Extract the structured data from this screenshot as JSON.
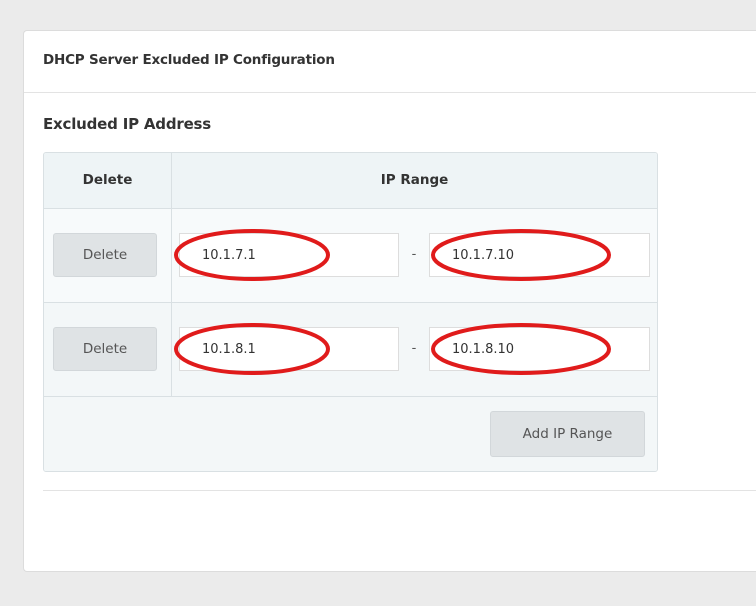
{
  "panel": {
    "title": "DHCP Server Excluded IP Configuration"
  },
  "section": {
    "title": "Excluded IP Address"
  },
  "table": {
    "headers": {
      "delete": "Delete",
      "ip_range": "IP Range"
    },
    "rows": [
      {
        "delete_label": "Delete",
        "start_ip": "10.1.7.1",
        "separator": "-",
        "end_ip": "10.1.7.10"
      },
      {
        "delete_label": "Delete",
        "start_ip": "10.1.8.1",
        "separator": "-",
        "end_ip": "10.1.8.10"
      }
    ],
    "add_button_label": "Add IP Range"
  },
  "annotation": {
    "shape": "ellipse",
    "color": "#e01b1b",
    "highlighted_fields": [
      "start_ip",
      "end_ip"
    ]
  },
  "colors": {
    "page_background": "#ebebeb",
    "panel_background": "#ffffff",
    "table_background": "#f3f7f8",
    "button_background": "#dfe3e5"
  }
}
